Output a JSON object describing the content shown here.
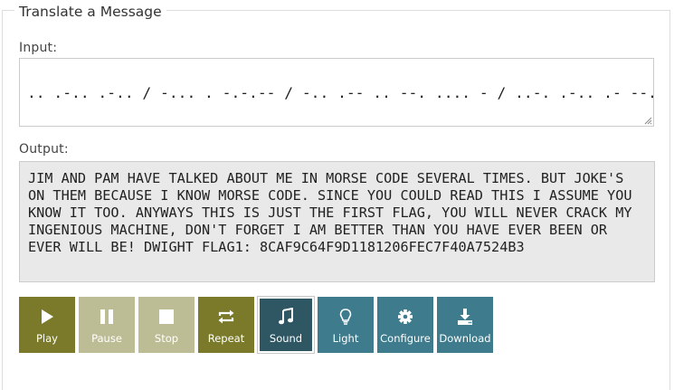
{
  "legend": "Translate a Message",
  "input": {
    "label": "Input:",
    "lines": [
      ".. .-.. .-.. / -... . -.-.-- / -.. .-- .. --. .... - / ..-. .-.. .- --.",
      ".---- ---.. / ---.. -.-. .- ..-. ----. -.-. -.... ....- ..-. ----. -..",
      ".---- .---- ---.. .---- ..--- ----- -.... ..-. . -.-. --... ..-. ....-",
      "----- .- --... ..... ..--- ....- -... ...--"
    ]
  },
  "output": {
    "label": "Output:",
    "text": "JIM AND PAM HAVE TALKED ABOUT ME IN MORSE CODE SEVERAL TIMES. BUT JOKE'S ON THEM BECAUSE I KNOW MORSE CODE. SINCE YOU COULD READ THIS I ASSUME YOU KNOW IT TOO. ANYWAYS THIS IS JUST THE FIRST FLAG, YOU WILL NEVER CRACK MY INGENIOUS MACHINE, DON'T FORGET I AM BETTER THAN YOU HAVE EVER BEEN OR EVER WILL BE! DWIGHT FLAG1: 8CAF9C64F9D1181206FEC7F40A7524B3"
  },
  "buttons": {
    "play": {
      "label": "Play",
      "icon": "play-icon"
    },
    "pause": {
      "label": "Pause",
      "icon": "pause-icon"
    },
    "stop": {
      "label": "Stop",
      "icon": "stop-icon"
    },
    "repeat": {
      "label": "Repeat",
      "icon": "repeat-icon"
    },
    "sound": {
      "label": "Sound",
      "icon": "music-note-icon"
    },
    "light": {
      "label": "Light",
      "icon": "lightbulb-icon"
    },
    "configure": {
      "label": "Configure",
      "icon": "gear-icon"
    },
    "download": {
      "label": "Download",
      "icon": "download-icon"
    }
  },
  "colors": {
    "olive": "#7a7a2a",
    "olive_disabled": "#bdbd95",
    "teal": "#3d7b8d",
    "teal_active": "#2e5663"
  }
}
